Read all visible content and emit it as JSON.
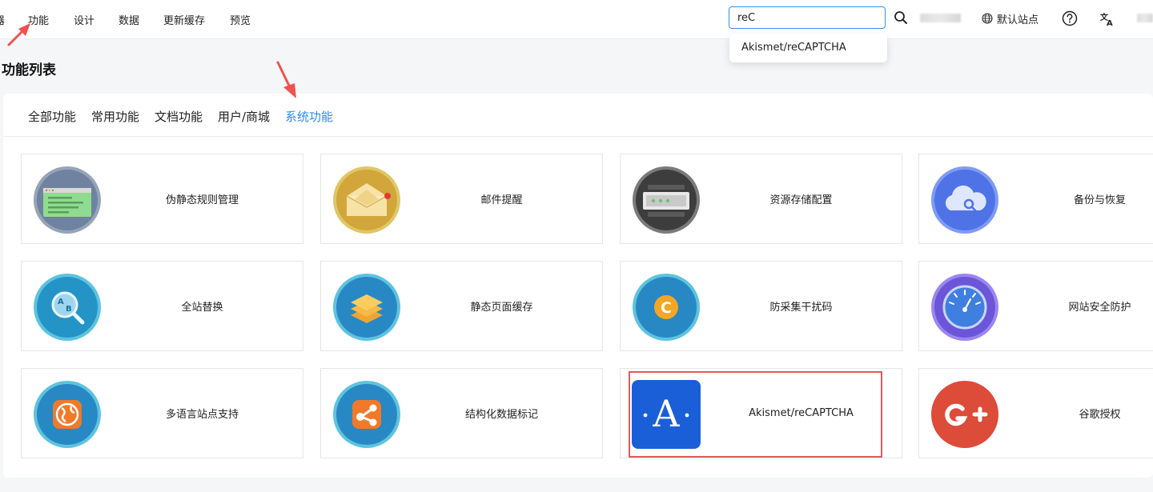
{
  "nav": {
    "cut_item": "器",
    "items": [
      "功能",
      "设计",
      "数据",
      "更新缓存",
      "预览"
    ]
  },
  "search": {
    "value": "reC",
    "suggestion": "Akismet/reCAPTCHA"
  },
  "header": {
    "default_site": "默认站点"
  },
  "page": {
    "title": "功能列表"
  },
  "tabs": [
    {
      "label": "全部功能",
      "active": false
    },
    {
      "label": "常用功能",
      "active": false
    },
    {
      "label": "文档功能",
      "active": false
    },
    {
      "label": "用户/商城",
      "active": false
    },
    {
      "label": "系统功能",
      "active": true
    }
  ],
  "features": [
    {
      "label": "伪静态规则管理",
      "icon": "rewrite-rules-icon"
    },
    {
      "label": "邮件提醒",
      "icon": "mail-reminder-icon"
    },
    {
      "label": "资源存储配置",
      "icon": "storage-config-icon"
    },
    {
      "label": "备份与恢复",
      "icon": "cloud-backup-icon"
    },
    {
      "label": "全站替换",
      "icon": "site-replace-icon"
    },
    {
      "label": "静态页面缓存",
      "icon": "static-cache-icon"
    },
    {
      "label": "防采集干扰码",
      "icon": "anti-scrape-icon"
    },
    {
      "label": "网站安全防护",
      "icon": "security-gauge-icon"
    },
    {
      "label": "多语言站点支持",
      "icon": "multilang-globe-icon"
    },
    {
      "label": "结构化数据标记",
      "icon": "structured-data-icon"
    },
    {
      "label": "Akismet/reCAPTCHA",
      "icon": "akismet-icon",
      "highlighted": true
    },
    {
      "label": "谷歌授权",
      "icon": "google-plus-icon"
    }
  ],
  "colors": {
    "accent": "#2d8cf0",
    "highlight_border": "#e05a5a",
    "annotation_arrow": "#ef5350"
  }
}
